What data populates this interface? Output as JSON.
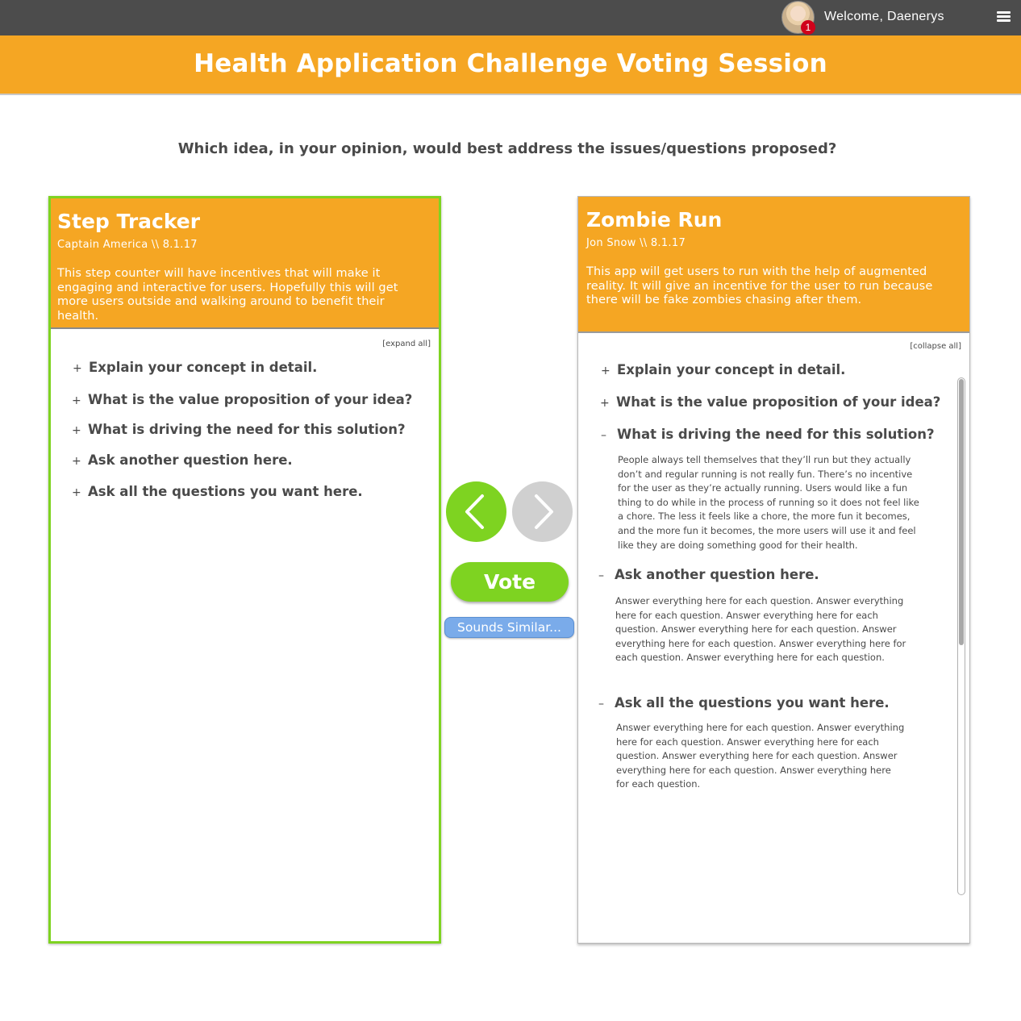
{
  "topbar": {
    "avatar_icon": "user-avatar",
    "notification_count": "1",
    "welcome_text": "Welcome, Daenerys",
    "menu_icon": "hamburger-menu-icon"
  },
  "banner": {
    "title": "Health Application Challenge Voting Session"
  },
  "prompt": "Which idea, in your opinion, would best address the issues/questions proposed?",
  "left_card": {
    "title": "Step Tracker",
    "meta": "Captain America \\\\ 8.1.17",
    "description": "This step counter will have incentives that will make it engaging and interactive for users. Hopefully this will get more users outside and walking around to benefit their health.",
    "toggle_label": "[expand all]",
    "questions": [
      {
        "sign": "+",
        "text": "Explain your concept in detail."
      },
      {
        "sign": "+",
        "text": "What is the value proposition of your idea?"
      },
      {
        "sign": "+",
        "text": "What is driving the need for this solution?"
      },
      {
        "sign": "+",
        "text": "Ask another question here."
      },
      {
        "sign": "+",
        "text": "Ask all the questions you want here."
      }
    ]
  },
  "right_card": {
    "title": "Zombie Run",
    "meta": "Jon Snow \\\\ 8.1.17",
    "description": "This app will get users to run with the help of augmented reality. It will give an incentive for the user to run because there will be fake zombies chasing after them.",
    "toggle_label": "[collapse all]",
    "questions": [
      {
        "sign": "+",
        "text": "Explain your concept in detail."
      },
      {
        "sign": "+",
        "text": "What is the value proposition of your idea?"
      },
      {
        "sign": "–",
        "text": "What is driving the need for this solution?"
      },
      {
        "sign": "–",
        "text": "Ask another question here."
      },
      {
        "sign": "–",
        "text": "Ask all the questions you want here."
      }
    ],
    "answers": [
      "People always tell themselves that they’ll run but they actually don’t and regular running is not really fun. There’s no incentive for the user as they’re actually running. Users would like a fun thing to do while in the process of running so it does not feel like a chore. The less it feels like a chore, the more fun it becomes, and the more fun it becomes, the more users will use it and feel like they are doing something good for their health.",
      "Answer everything here for each question. Answer everything here for each question. Answer everything here for each question. Answer everything here for each question. Answer everything here for each question. Answer everything here for each question. Answer everything here for each question.",
      "Answer everything here for each question. Answer everything here for each question. Answer everything here for each question. Answer everything here for each question. Answer everything here for each question. Answer everything here for each question."
    ]
  },
  "controls": {
    "prev_icon": "chevron-left-icon",
    "next_icon": "chevron-right-icon",
    "vote_label": "Vote",
    "similar_label": "Sounds Similar..."
  },
  "colors": {
    "accent_orange": "#f5a623",
    "accent_green": "#7ed321",
    "topbar": "#4c4c4c",
    "similar_blue": "#7aabea"
  }
}
